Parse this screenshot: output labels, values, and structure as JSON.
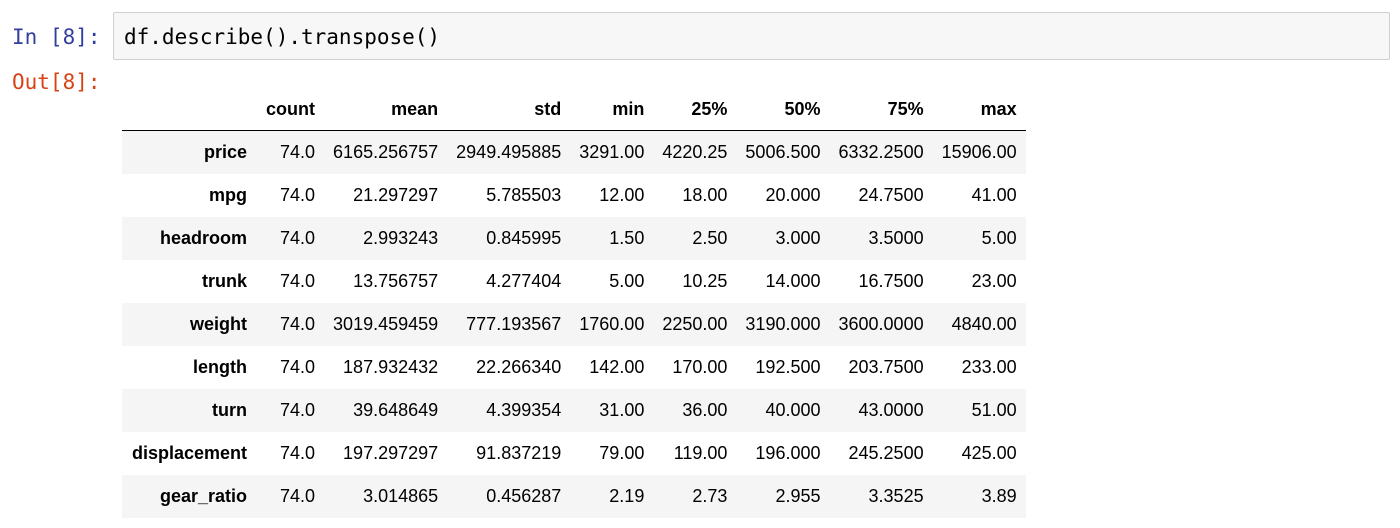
{
  "input_cell": {
    "prompt": "In [8]:",
    "code": "df.describe().transpose()"
  },
  "output_cell": {
    "prompt": "Out[8]:"
  },
  "table": {
    "columns": [
      "count",
      "mean",
      "std",
      "min",
      "25%",
      "50%",
      "75%",
      "max"
    ],
    "rows": [
      {
        "index": "price",
        "values": [
          "74.0",
          "6165.256757",
          "2949.495885",
          "3291.00",
          "4220.25",
          "5006.500",
          "6332.2500",
          "15906.00"
        ]
      },
      {
        "index": "mpg",
        "values": [
          "74.0",
          "21.297297",
          "5.785503",
          "12.00",
          "18.00",
          "20.000",
          "24.7500",
          "41.00"
        ]
      },
      {
        "index": "headroom",
        "values": [
          "74.0",
          "2.993243",
          "0.845995",
          "1.50",
          "2.50",
          "3.000",
          "3.5000",
          "5.00"
        ]
      },
      {
        "index": "trunk",
        "values": [
          "74.0",
          "13.756757",
          "4.277404",
          "5.00",
          "10.25",
          "14.000",
          "16.7500",
          "23.00"
        ]
      },
      {
        "index": "weight",
        "values": [
          "74.0",
          "3019.459459",
          "777.193567",
          "1760.00",
          "2250.00",
          "3190.000",
          "3600.0000",
          "4840.00"
        ]
      },
      {
        "index": "length",
        "values": [
          "74.0",
          "187.932432",
          "22.266340",
          "142.00",
          "170.00",
          "192.500",
          "203.7500",
          "233.00"
        ]
      },
      {
        "index": "turn",
        "values": [
          "74.0",
          "39.648649",
          "4.399354",
          "31.00",
          "36.00",
          "40.000",
          "43.0000",
          "51.00"
        ]
      },
      {
        "index": "displacement",
        "values": [
          "74.0",
          "197.297297",
          "91.837219",
          "79.00",
          "119.00",
          "196.000",
          "245.2500",
          "425.00"
        ]
      },
      {
        "index": "gear_ratio",
        "values": [
          "74.0",
          "3.014865",
          "0.456287",
          "2.19",
          "2.73",
          "2.955",
          "3.3525",
          "3.89"
        ]
      }
    ]
  },
  "colors": {
    "in_prompt": "#303f9f",
    "out_prompt": "#d84315",
    "code_background": "#f7f7f7",
    "code_border": "#cfcfcf",
    "row_stripe": "#f5f5f5"
  }
}
